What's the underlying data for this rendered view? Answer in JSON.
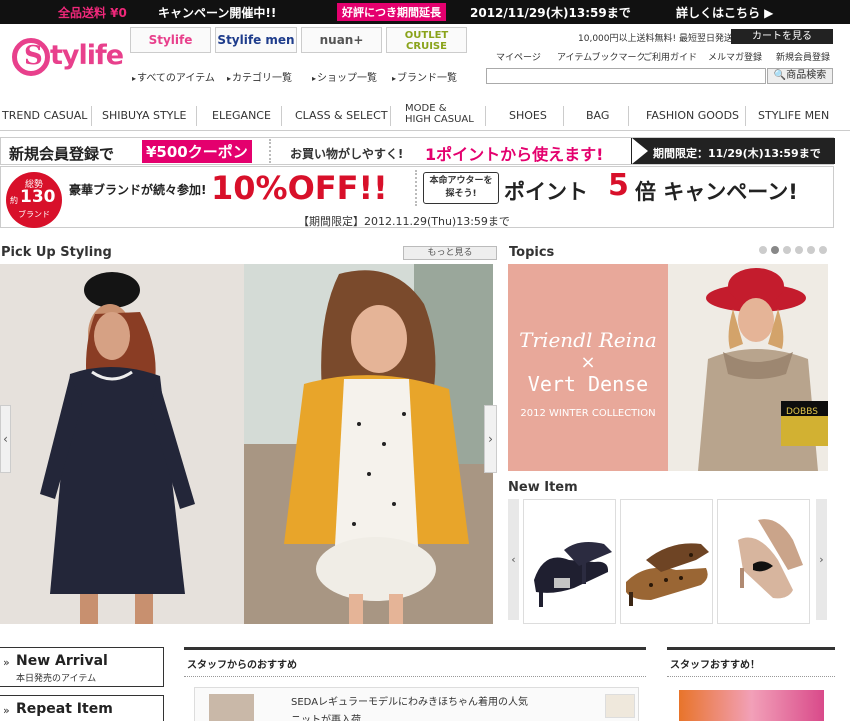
{
  "topbar": {
    "free_shipping": "全品送料 ¥0",
    "campaign": "キャンペーン開催中!!",
    "badge": "好評につき期間延長",
    "datetime": "2012/11/29(木)13:59まで",
    "more_link": "詳しくはこちら ▶"
  },
  "header": {
    "logo_letter": "S",
    "logo_text": "tylife",
    "brand_tabs": [
      "Stylife",
      "Stylife men",
      "nuan+",
      "OUTLET CRUISE"
    ],
    "free_shipping_note": "10,000円以上送料無料! 最短翌日発送",
    "cart_label": "カートを見る",
    "links": [
      "マイページ",
      "アイテムブックマーク",
      "ご利用ガイド",
      "メルマガ登録",
      "新規会員登録"
    ],
    "nav": [
      "すべてのアイテム",
      "カテゴリ一覧",
      "ショップ一覧",
      "ブランド一覧"
    ],
    "search_button": "商品検索"
  },
  "categories": [
    "TREND CASUAL",
    "SHIBUYA STYLE",
    "ELEGANCE",
    "CLASS & SELECT",
    "MODE &",
    "HIGH CASUAL",
    "SHOES",
    "BAG",
    "FASHION GOODS",
    "STYLIFE MEN"
  ],
  "banner1": {
    "register": "新規会員登録で",
    "coupon": "¥500クーポン",
    "easy": "お買い物がしやすく!",
    "points": "1ポイントから使えます!",
    "limited": "期間限定：11/29(木)13:59まで"
  },
  "banner2": {
    "circle_top": "総勢",
    "circle_pre": "約",
    "circle_num": "130",
    "circle_bottom": "ブランド",
    "luxury": "豪華ブランドが続々参加!",
    "off": "10%OFF!!",
    "outer_line1": "本命アウターを",
    "outer_line2": "探そう!",
    "point_camp_a": "ポイント",
    "point_camp_num": "5",
    "point_camp_b": "倍 キャンペーン!",
    "period": "【期間限定】2012.11.29(Thu)13:59まで"
  },
  "pickup": {
    "title": "Pick Up Styling",
    "more": "もっと見る",
    "prev": "‹",
    "next": "›"
  },
  "topics": {
    "title": "Topics",
    "line1": "Triendl Reina",
    "line2": "×",
    "line3": "Vert Dense",
    "line4": "2012 WINTER COLLECTION",
    "box_label": "DOBBS"
  },
  "new_item": {
    "title": "New Item",
    "prev": "‹",
    "next": "›"
  },
  "lower": {
    "new_arrival": "New Arrival",
    "new_arrival_sub": "本日発売のアイテム",
    "repeat_item": "Repeat Item",
    "arrow": "»",
    "staff_title": "スタッフからのおすすめ",
    "staff_line1": "SEDAレギュラーモデルにわみきほちゃん着用の人気",
    "staff_line2": "ニットが再入荷…",
    "staff_pick_title": "スタッフおすすめ！"
  },
  "colors": {
    "brand_pink": "#e8408c",
    "accent_magenta": "#e4006e",
    "promo_red": "#d8102a"
  }
}
